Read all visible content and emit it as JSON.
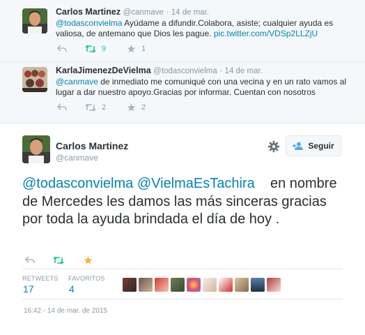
{
  "context": [
    {
      "name": "Carlos Martinez",
      "handle": "@canmave",
      "time": "14 de mar.",
      "text_mention": "@todasconvielma",
      "text_body": " Ayúdame a difundir.Colabora, asiste; cualquier ayuda es valiosa, de antemano que Dios les pague. ",
      "text_link": "pic.twitter.com/VDSp2LLZjU",
      "retweets": "9",
      "favorites": "1"
    },
    {
      "name": "KarlaJimenezDeVielma",
      "handle": "@todasconvielma",
      "time": "14 de mar.",
      "text_mention": "@canmave",
      "text_body": " de inmediato me comuniqué con una vecina y en un rato vamos al lugar a dar nuestro apoyo.Gracias por informar. Cuentan con nosotros",
      "retweets": "2",
      "favorites": "2"
    }
  ],
  "main": {
    "name": "Carlos Martinez",
    "handle": "@canmave",
    "follow_label": "Seguir",
    "mention1": "@todasconvielma",
    "mention2": "@VielmaEsTachira",
    "body": "en nombre de Mercedes les damos las más sinceras gracias por  toda la ayuda brindada el día de hoy .",
    "retweets_label": "RETWEETS",
    "retweets_count": "17",
    "favorites_label": "FAVORITOS",
    "favorites_count": "4",
    "timestamp": "16:42 - 14 de mar. de 2015"
  },
  "colors": {
    "accent": "#0084b4",
    "retweet_active": "#19cf86",
    "favorite_active": "#ffac33",
    "muted": "#8899a6"
  }
}
